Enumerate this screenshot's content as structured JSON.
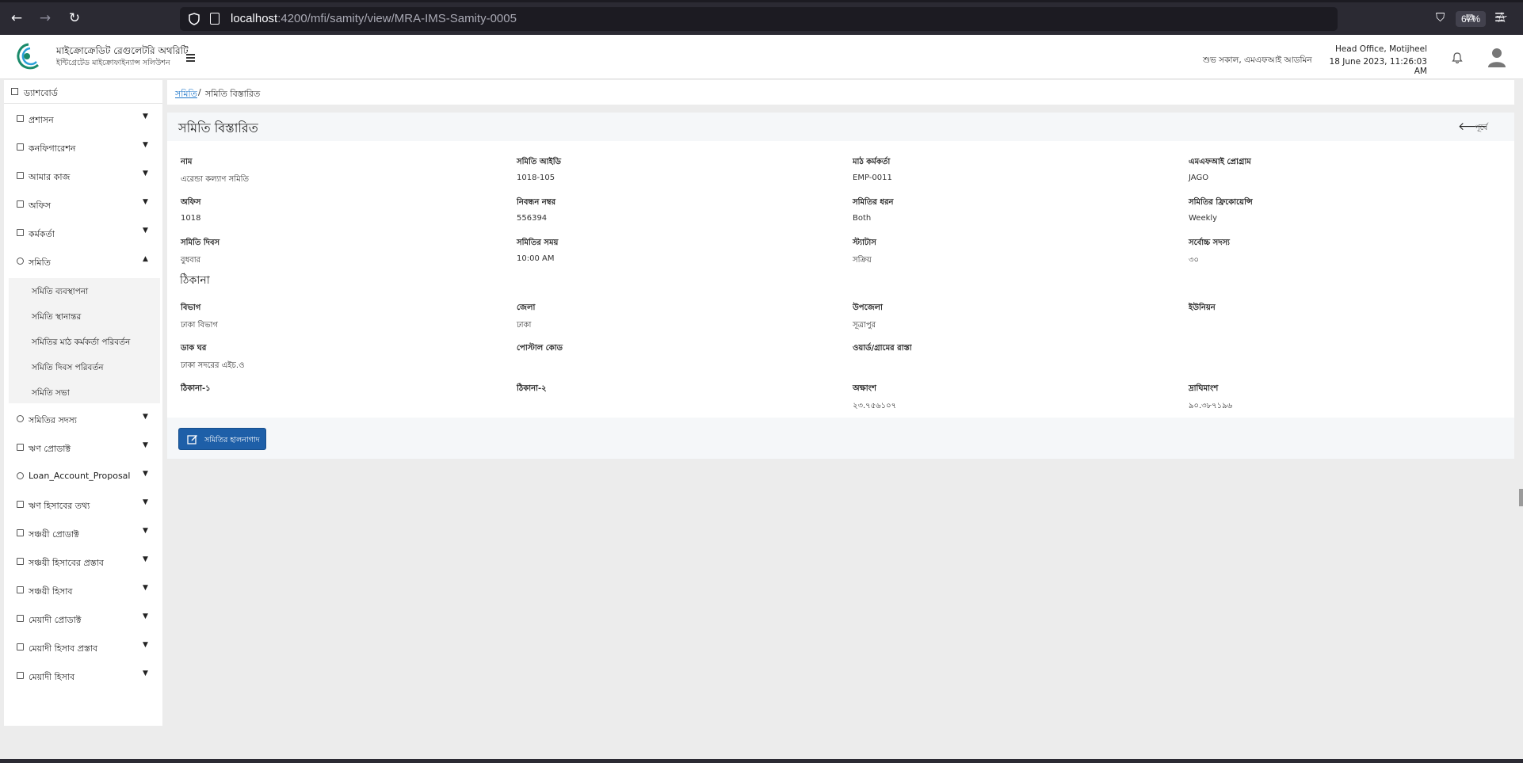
{
  "browser": {
    "url_host": "localhost",
    "url_rest": ":4200/mfi/samity/view/MRA-IMS-Samity-0005",
    "zoom": "67%"
  },
  "header": {
    "brand_title": "মাইক্রোক্রেডিট রেগুলেটরি অথরিটি",
    "brand_sub": "ইন্টিগ্রেটেড মাইক্রোফাইন্যান্স সলিউশন",
    "greeting": "শুভ সকাল, এমএফআই আডমিন",
    "office": "Head Office, Motijheel",
    "datetime": "18 June 2023, 11:26:03 AM"
  },
  "sidebar": {
    "dashboard": "ড্যাশবোর্ড",
    "items": [
      {
        "label": "প্রশাসন"
      },
      {
        "label": "কনফিগারেশন"
      },
      {
        "label": "আমার কাজ"
      },
      {
        "label": "অফিস"
      },
      {
        "label": "কর্মকর্তা"
      },
      {
        "label": "সমিতি"
      },
      {
        "label": "সমিতির সদস্য"
      },
      {
        "label": "ঋণ প্রোডাক্ট"
      },
      {
        "label": "Loan_Account_Proposal"
      },
      {
        "label": "ঋণ হিসাবের তথ্য"
      },
      {
        "label": "সঞ্চয়ী প্রোডাক্ট"
      },
      {
        "label": "সঞ্চয়ী হিসাবের প্রস্তাব"
      },
      {
        "label": "সঞ্চয়ী হিসাব"
      },
      {
        "label": "মেয়াদী প্রোডাক্ট"
      },
      {
        "label": "মেয়াদী হিসাব প্রস্তাব"
      },
      {
        "label": "মেয়াদী হিসাব"
      }
    ],
    "sub_items": [
      {
        "label": "সমিতি ব্যবস্থাপনা"
      },
      {
        "label": "সমিতি স্থানান্তর"
      },
      {
        "label": "সমিতির মাঠ কর্মকর্তা পরিবর্তন"
      },
      {
        "label": "সমিতি দিবস পরিবর্তন"
      },
      {
        "label": "সমিতি সভা"
      }
    ]
  },
  "breadcrumb": {
    "link": "সমিতি",
    "separator": "/",
    "current": "সমিতি বিস্তারিত"
  },
  "card": {
    "title": "সমিতি বিস্তারিত",
    "back_label": "পূর্বে",
    "fields": [
      {
        "label": "নাম",
        "value": "এরেন্ডা কল্যাণ সমিতি"
      },
      {
        "label": "সমিতি আইডি",
        "value": "1018-105"
      },
      {
        "label": "মাঠ কর্মকর্তা",
        "value": "EMP-0011"
      },
      {
        "label": "এমএফআই প্রোগ্রাম",
        "value": "JAGO"
      },
      {
        "label": "অফিস",
        "value": "1018"
      },
      {
        "label": "নিবন্ধন নম্বর",
        "value": "556394"
      },
      {
        "label": "সমিতির ধরন",
        "value": "Both"
      },
      {
        "label": "সমিতির ফ্রিকোয়েন্সি",
        "value": "Weekly"
      },
      {
        "label": "সমিতি দিবস",
        "value": "বুধবার"
      },
      {
        "label": "সমিতির সময়",
        "value": "10:00 AM"
      },
      {
        "label": "স্ট্যাটাস",
        "value": "সক্রিয়"
      },
      {
        "label": "সর্বোচ্চ সদস্য",
        "value": "৩০"
      }
    ],
    "address_title": "ঠিকানা",
    "address_fields": [
      {
        "label": "বিভাগ",
        "value": "ঢাকা বিভাগ"
      },
      {
        "label": "জেলা",
        "value": "ঢাকা"
      },
      {
        "label": "উপজেলা",
        "value": "সূত্রাপুর"
      },
      {
        "label": "ইউনিয়ন",
        "value": ""
      },
      {
        "label": "ডাক ঘর",
        "value": "ঢাকা সদরের এইচ.ও"
      },
      {
        "label": "পোস্টাল কোড",
        "value": ""
      },
      {
        "label": "ওয়ার্ড/গ্রামের রাস্তা",
        "value": ""
      },
      {
        "label": "",
        "value": ""
      },
      {
        "label": "ঠিকানা-১",
        "value": ""
      },
      {
        "label": "ঠিকানা-২",
        "value": ""
      },
      {
        "label": "অক্ষাংশ",
        "value": "২৩.৭৫৬১০৭"
      },
      {
        "label": "দ্রাঘিমাংশ",
        "value": "৯০.৩৮৭১৯৬"
      }
    ],
    "edit_button": "সমিতির হালনাগাদ"
  }
}
